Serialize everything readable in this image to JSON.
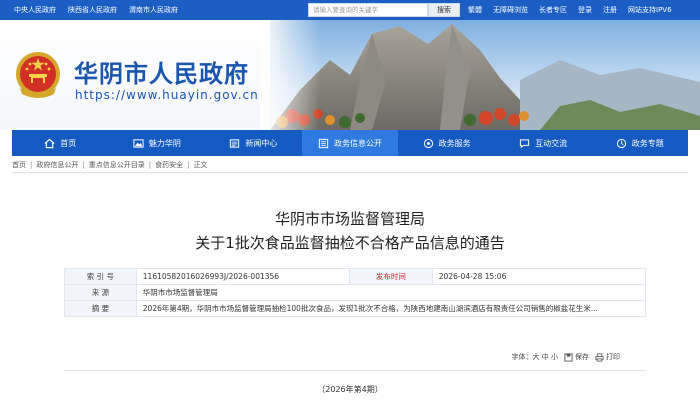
{
  "topbar": {
    "links": [
      "中央人民政府",
      "陕西省人民政府",
      "渭南市人民政府"
    ],
    "search": {
      "placeholder": "请输入要查询的关键字",
      "button": "搜索"
    },
    "tools": [
      "繁體",
      "无障碍浏览",
      "长者专区",
      "登录",
      "注册",
      "网站支持IPV6"
    ]
  },
  "header": {
    "site_title": "华阴市人民政府",
    "site_url": "https://www.huayin.gov.cn"
  },
  "nav": {
    "items": [
      {
        "label": "首页",
        "icon": "home-icon"
      },
      {
        "label": "魅力华阴",
        "icon": "landscape-icon"
      },
      {
        "label": "新闻中心",
        "icon": "newspaper-icon"
      },
      {
        "label": "政务信息公开",
        "icon": "list-icon"
      },
      {
        "label": "政务服务",
        "icon": "service-icon"
      },
      {
        "label": "互动交流",
        "icon": "chat-icon"
      },
      {
        "label": "政务专题",
        "icon": "topic-icon"
      }
    ],
    "active_index": 3
  },
  "breadcrumb": [
    "首页",
    "政府信息公开",
    "重点信息公开目录",
    "食药安全",
    "正文"
  ],
  "article": {
    "title_line1": "华阴市市场监督管理局",
    "title_line2": "关于1批次食品监督抽检不合格产品信息的通告",
    "meta": {
      "index_label": "索  引  号",
      "index_value": "11610582016026993J/2026-001356",
      "date_label": "发布时间",
      "date_value": "2026-04-28 15:06",
      "source_label": "来    源",
      "source_value": "华阴市市场监督管理局",
      "summary_label": "摘    要",
      "summary_value": "2026年第4期，华阴市市场监督管理局抽检100批次食品，发现1批次不合格，为陕西地建南山湖滨酒店有限责任公司销售的椒盐花生米..."
    },
    "font_size_label": "字体：大 中 小",
    "save_label": "保存",
    "print_label": "打印",
    "issue_label": "（2026年第4期）"
  },
  "colors": {
    "primary": "#1559c2",
    "nav_active": "#2f7ae0",
    "topbar": "#1d5ec4",
    "accent_red": "#c9292f"
  }
}
